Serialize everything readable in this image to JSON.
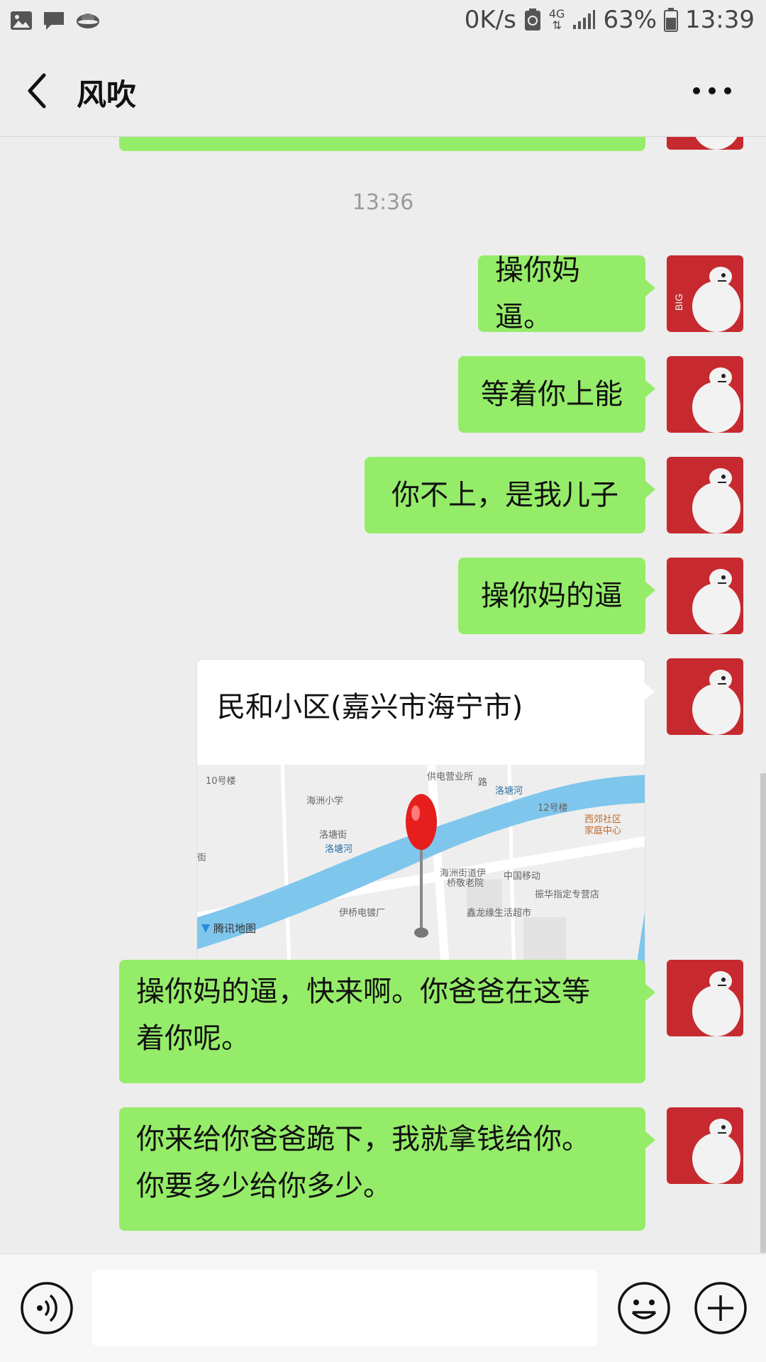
{
  "status_bar": {
    "net_speed": "0K/s",
    "network": "4G",
    "battery": "63%",
    "time": "13:39"
  },
  "nav": {
    "title": "风吹",
    "back_icon": "chevron-left-icon",
    "more_icon": "more-dots-icon"
  },
  "chat": {
    "timestamp": "13:36",
    "messages": [
      {
        "text": "操你妈逼。"
      },
      {
        "text": "等着你上能"
      },
      {
        "text": "你不上，是我儿子"
      },
      {
        "text": "操你妈的逼"
      },
      {
        "text": "操你妈的逼，快来啊。你爸爸在这等着你呢。",
        "line1": "操你妈的逼，快来啊。你爸爸在这等",
        "line2": "着你呢。"
      },
      {
        "text": "你来给你爸爸跪下，我就拿钱给你。你要多少给你多少。",
        "line1": "你来给你爸爸跪下，我就拿钱给你。",
        "line2": "你要多少给你多少。"
      }
    ],
    "location": {
      "name": "民和小区(嘉兴市海宁市)",
      "map_labels": {
        "bldg10": "10号楼",
        "school": "海洲小学",
        "power": "供电营业所",
        "street1": "洛塘街",
        "river1": "洛塘河",
        "river2": "洛塘河",
        "bldg12": "12号楼",
        "community": "西郊社区",
        "community2": "家庭中心",
        "road": "路",
        "nursing": "海洲街道伊",
        "nursing2": "桥敬老院",
        "mobile": "中国移动",
        "zhenhua": "振华指定专营店",
        "factory": "伊桥电镀厂",
        "supermarket": "鑫龙缘生活超市",
        "street2": "街",
        "brand": "腾讯地图"
      }
    }
  },
  "input_bar": {
    "voice_icon": "voice-icon",
    "emoji_icon": "emoji-icon",
    "plus_icon": "plus-icon",
    "input_value": ""
  },
  "colors": {
    "bubble_green": "#95ec69",
    "background": "#ededed",
    "avatar_red": "#c62a2f"
  }
}
